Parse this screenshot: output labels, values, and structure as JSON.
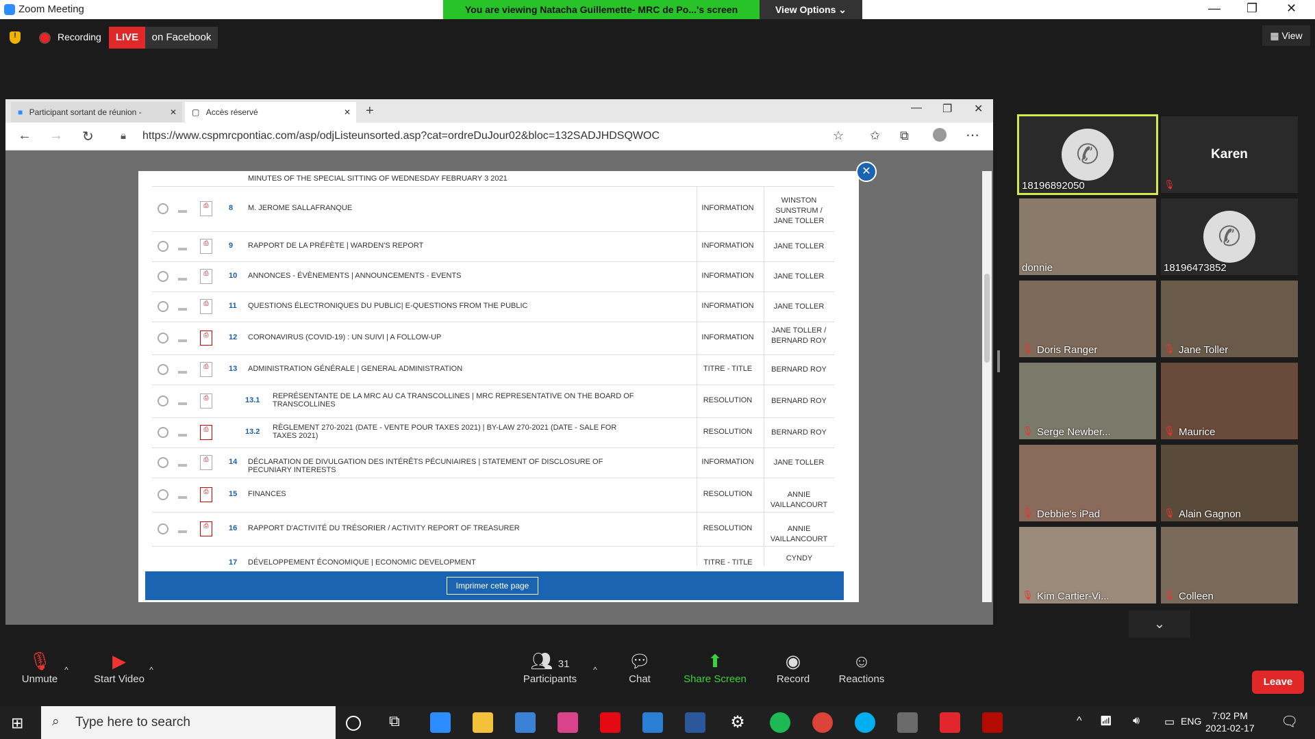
{
  "window": {
    "title": "Zoom Meeting"
  },
  "banner": {
    "text": "You are viewing Natacha Guillemette- MRC de Po...'s screen",
    "view_options": "View Options ⌄"
  },
  "meeting_bar": {
    "recording": "Recording",
    "live": "LIVE",
    "on_facebook": "on Facebook",
    "view": "View"
  },
  "browser": {
    "tabs": [
      {
        "label": "Participant sortant de réunion - "
      },
      {
        "label": "Accès réservé"
      }
    ],
    "url": "https://www.cspmrcpontiac.com/asp/odjListeunsorted.asp?cat=ordreDuJour02&bloc=132SADJHDSQWOC"
  },
  "agenda": {
    "partial_top": "MINUTES OF THE SPECIAL SITTING OF WEDNESDAY FEBRUARY 3 2021",
    "rows": [
      {
        "num": "8",
        "title": "M. JEROME SALLAFRANQUE",
        "type": "INFORMATION",
        "who": "WINSTON SUNSTRUM / JANE TOLLER",
        "pdf": "gray"
      },
      {
        "num": "9",
        "title": "RAPPORT DE LA PRÉFÈTE | WARDEN'S REPORT",
        "type": "INFORMATION",
        "who": "JANE TOLLER",
        "pdf": "gray"
      },
      {
        "num": "10",
        "title": "ANNONCES - ÉVÈNEMENTS | ANNOUNCEMENTS - EVENTS",
        "type": "INFORMATION",
        "who": "JANE TOLLER",
        "pdf": "gray"
      },
      {
        "num": "11",
        "title": "QUESTIONS ÉLECTRONIQUES DU PUBLIC| E-QUESTIONS FROM THE PUBLIC",
        "type": "INFORMATION",
        "who": "JANE TOLLER",
        "pdf": "gray"
      },
      {
        "num": "12",
        "title": "CORONAVIRUS (COVID-19) : UN SUIVI | A FOLLOW-UP",
        "type": "INFORMATION",
        "who": "JANE TOLLER / BERNARD ROY",
        "pdf": "red"
      },
      {
        "num": "13",
        "title": "ADMINISTRATION GÉNÉRALE | GENERAL ADMINISTRATION",
        "type": "TITRE - TITLE",
        "who": "BERNARD ROY",
        "pdf": "gray"
      },
      {
        "num": "13.1",
        "title": "REPRÉSENTANTE DE LA MRC AU CA TRANSCOLLINES | MRC REPRESENTATIVE ON THE BOARD OF TRANSCOLLINES",
        "type": "RESOLUTION",
        "who": "BERNARD ROY",
        "pdf": "gray",
        "sub": true
      },
      {
        "num": "13.2",
        "title": "RÈGLEMENT 270-2021 (DATE - VENTE POUR TAXES 2021) | BY-LAW 270-2021 (DATE - SALE FOR TAXES 2021)",
        "type": "RESOLUTION",
        "who": "BERNARD ROY",
        "pdf": "red",
        "sub": true
      },
      {
        "num": "14",
        "title": "DÉCLARATION DE DIVULGATION DES INTÉRÊTS PÉCUNIAIRES | STATEMENT OF DISCLOSURE OF PECUNIARY INTERESTS",
        "type": "INFORMATION",
        "who": "JANE TOLLER",
        "pdf": "gray"
      },
      {
        "num": "15",
        "title": "FINANCES",
        "type": "RESOLUTION",
        "who": "ANNIE VAILLANCOURT",
        "pdf": "red"
      },
      {
        "num": "16",
        "title": "RAPPORT D'ACTIVITÉ DU TRÉSORIER / ACTIVITY REPORT OF TREASURER",
        "type": "RESOLUTION",
        "who": "ANNIE VAILLANCOURT",
        "pdf": "red"
      }
    ],
    "partial_bottom": {
      "num": "17",
      "title": "DÉVELOPPEMENT ÉCONOMIQUE | ECONOMIC DEVELOPMENT",
      "type": "TITRE - TITLE",
      "who": "CYNDY"
    },
    "print_button": "Imprimer cette page"
  },
  "gallery": [
    {
      "name": "18196892050",
      "kind": "phone",
      "active": true
    },
    {
      "name": "Karen",
      "kind": "name"
    },
    {
      "name": "donnie",
      "kind": "video"
    },
    {
      "name": "18196473852",
      "kind": "phone"
    },
    {
      "name": "Doris Ranger",
      "kind": "video"
    },
    {
      "name": "Jane Toller",
      "kind": "video"
    },
    {
      "name": "Serge Newber...",
      "kind": "video"
    },
    {
      "name": "Maurice",
      "kind": "video"
    },
    {
      "name": "Debbie's iPad",
      "kind": "video"
    },
    {
      "name": "Alain Gagnon",
      "kind": "video"
    },
    {
      "name": "Kim Cartier-Vi...",
      "kind": "video"
    },
    {
      "name": "Colleen",
      "kind": "video"
    }
  ],
  "toolbar": {
    "unmute": "Unmute",
    "start_video": "Start Video",
    "participants": "Participants",
    "participant_count": "31",
    "chat": "Chat",
    "share_screen": "Share Screen",
    "record": "Record",
    "reactions": "Reactions",
    "leave": "Leave"
  },
  "taskbar": {
    "search_placeholder": "Type here to search",
    "lang": "ENG",
    "time": "7:02 PM",
    "date": "2021-02-17"
  }
}
